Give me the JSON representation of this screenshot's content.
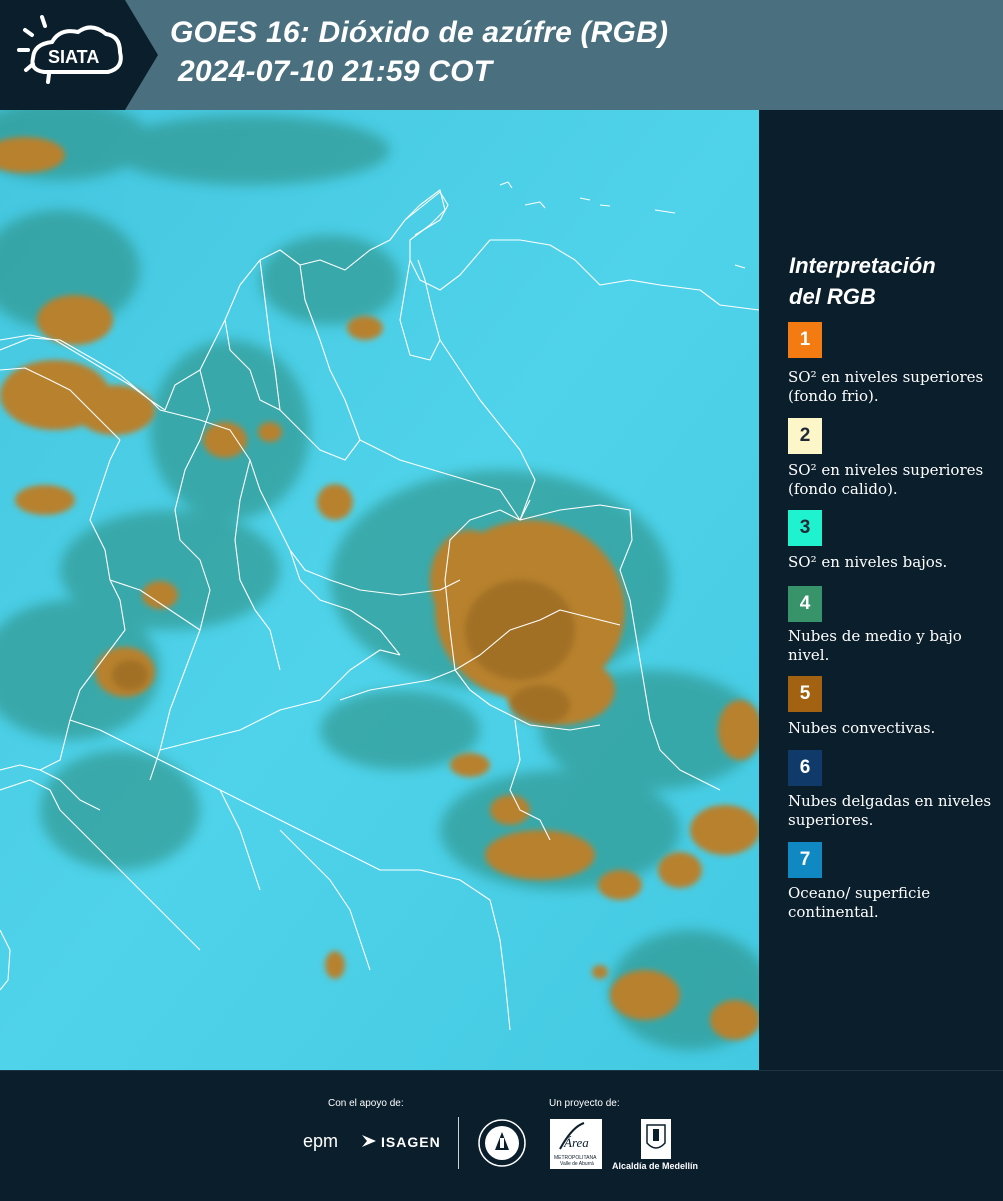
{
  "header": {
    "logo_text": "SIATA",
    "title_line1": "GOES 16: Dióxido de azúfre (RGB)",
    "title_line2": "2024-07-10 21:59 COT"
  },
  "legend": {
    "title_line1": "Interpretación",
    "title_line2": "del RGB",
    "items": [
      {
        "num": "1",
        "color": "#f47b12",
        "num_color": "#ffffff",
        "text": "SO² en niveles superiores (fondo frio)."
      },
      {
        "num": "2",
        "color": "#fdf6c9",
        "num_color": "#1e2a36",
        "text": "SO² en niveles superiores (fondo calido)."
      },
      {
        "num": "3",
        "color": "#1ef2cf",
        "num_color": "#1e2a36",
        "text": "SO² en niveles bajos."
      },
      {
        "num": "4",
        "color": "#36936a",
        "num_color": "#ffffff",
        "text": "Nubes de medio y bajo nivel."
      },
      {
        "num": "5",
        "color": "#a26212",
        "num_color": "#ffffff",
        "text": "Nubes convectivas."
      },
      {
        "num": "6",
        "color": "#0f3a6a",
        "num_color": "#ffffff",
        "text": "Nubes delgadas en niveles superiores."
      },
      {
        "num": "7",
        "color": "#1088c2",
        "num_color": "#ffffff",
        "text": "Oceano/ superficie continental."
      }
    ]
  },
  "footer": {
    "support_label": "Con el apoyo de:",
    "project_label": "Un proyecto de:",
    "sponsor1": "epm",
    "sponsor2": "ISAGEN",
    "area_name": "Área",
    "area_sub1": "METROPOLITANA",
    "area_sub2": "Valle de Aburrá",
    "alcaldia": "Alcaldía de Medellín"
  },
  "colors": {
    "header_bg": "#4a7080",
    "panel_bg": "#0b1e2c",
    "map_base": "#48cde6",
    "cloud_convective": "#b57f2e",
    "cloud_midlevel": "#2f8f82"
  }
}
